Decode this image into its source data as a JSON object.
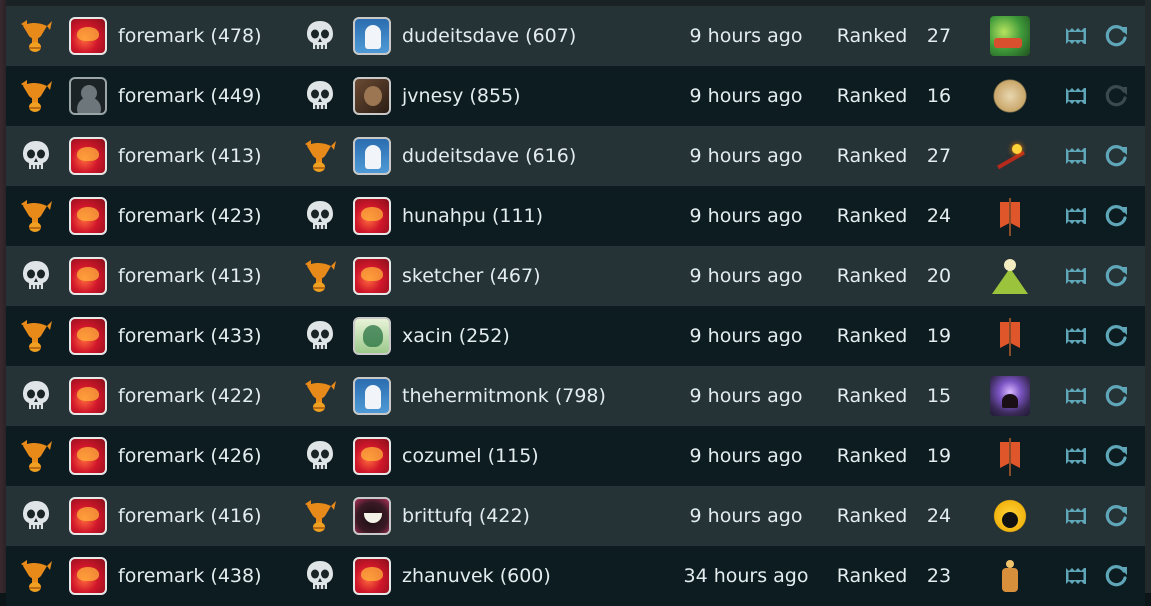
{
  "colors": {
    "row_odd": "#253236",
    "row_even": "#0d1c20",
    "text": "#e3ecee",
    "trophy": "#e88a1a",
    "skull": "#dfe5e6",
    "action": "#5fa7b8",
    "action_disabled": "#3a4a4f"
  },
  "matches": [
    {
      "p1_result": "trophy-icon",
      "p1_avatar": "dragon",
      "p1_name": "foremark (478)",
      "p2_result": "skull-icon",
      "p2_avatar": "wizard",
      "p2_name": "dudeitsdave (607)",
      "time": "9 hours ago",
      "mode": "Ranked",
      "turns": "27",
      "emblem": "dragon",
      "rematch_enabled": true
    },
    {
      "p1_result": "trophy-icon",
      "p1_avatar": "default",
      "p1_name": "foremark (449)",
      "p2_result": "skull-icon",
      "p2_avatar": "photo",
      "p2_name": "jvnesy (855)",
      "time": "9 hours ago",
      "mode": "Ranked",
      "turns": "16",
      "emblem": "hourglass",
      "rematch_enabled": false
    },
    {
      "p1_result": "skull-icon",
      "p1_avatar": "dragon",
      "p1_name": "foremark (413)",
      "p2_result": "trophy-icon",
      "p2_avatar": "wizard",
      "p2_name": "dudeitsdave (616)",
      "time": "9 hours ago",
      "mode": "Ranked",
      "turns": "27",
      "emblem": "arrow",
      "rematch_enabled": true
    },
    {
      "p1_result": "trophy-icon",
      "p1_avatar": "dragon",
      "p1_name": "foremark (423)",
      "p2_result": "skull-icon",
      "p2_avatar": "dragon",
      "p2_name": "hunahpu (111)",
      "time": "9 hours ago",
      "mode": "Ranked",
      "turns": "24",
      "emblem": "banner",
      "rematch_enabled": true
    },
    {
      "p1_result": "skull-icon",
      "p1_avatar": "dragon",
      "p1_name": "foremark (413)",
      "p2_result": "trophy-icon",
      "p2_avatar": "dragon",
      "p2_name": "sketcher (467)",
      "time": "9 hours ago",
      "mode": "Ranked",
      "turns": "20",
      "emblem": "mountain",
      "rematch_enabled": true
    },
    {
      "p1_result": "trophy-icon",
      "p1_avatar": "dragon",
      "p1_name": "foremark (433)",
      "p2_result": "skull-icon",
      "p2_avatar": "anime",
      "p2_name": "xacin (252)",
      "time": "9 hours ago",
      "mode": "Ranked",
      "turns": "19",
      "emblem": "banner",
      "rematch_enabled": true
    },
    {
      "p1_result": "skull-icon",
      "p1_avatar": "dragon",
      "p1_name": "foremark (422)",
      "p2_result": "trophy-icon",
      "p2_avatar": "wizard",
      "p2_name": "thehermitmonk (798)",
      "time": "9 hours ago",
      "mode": "Ranked",
      "turns": "15",
      "emblem": "hood",
      "rematch_enabled": true
    },
    {
      "p1_result": "trophy-icon",
      "p1_avatar": "dragon",
      "p1_name": "foremark (426)",
      "p2_result": "skull-icon",
      "p2_avatar": "dragon",
      "p2_name": "cozumel (115)",
      "time": "9 hours ago",
      "mode": "Ranked",
      "turns": "19",
      "emblem": "banner",
      "rematch_enabled": true
    },
    {
      "p1_result": "skull-icon",
      "p1_avatar": "dragon",
      "p1_name": "foremark (416)",
      "p2_result": "trophy-icon",
      "p2_avatar": "monster",
      "p2_name": "brittufq (422)",
      "time": "9 hours ago",
      "mode": "Ranked",
      "turns": "24",
      "emblem": "moon",
      "rematch_enabled": true
    },
    {
      "p1_result": "trophy-icon",
      "p1_avatar": "dragon",
      "p1_name": "foremark (438)",
      "p2_result": "skull-icon",
      "p2_avatar": "dragon",
      "p2_name": "zhanuvek (600)",
      "time": "34 hours ago",
      "mode": "Ranked",
      "turns": "23",
      "emblem": "figure",
      "rematch_enabled": true
    }
  ]
}
